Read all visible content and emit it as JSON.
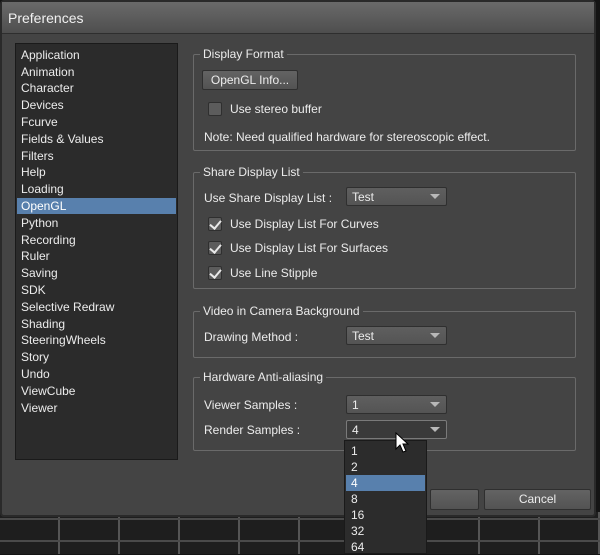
{
  "window": {
    "title": "Preferences"
  },
  "categories": {
    "selected": "OpenGL",
    "items": [
      "Application",
      "Animation",
      "Character",
      "Devices",
      "Fcurve",
      "Fields & Values",
      "Filters",
      "Help",
      "Loading",
      "OpenGL",
      "Python",
      "Recording",
      "Ruler",
      "Saving",
      "SDK",
      "Selective Redraw",
      "Shading",
      "SteeringWheels",
      "Story",
      "Undo",
      "ViewCube",
      "Viewer"
    ]
  },
  "display_format": {
    "title": "Display Format",
    "info_button": "OpenGL Info...",
    "stereo_label": "Use stereo buffer",
    "stereo_checked": false,
    "note": "Note: Need qualified hardware for stereoscopic effect."
  },
  "share_display_list": {
    "title": "Share Display List",
    "label": "Use Share Display List :",
    "value": "Test",
    "curves_label": "Use Display List For Curves",
    "curves_checked": true,
    "surfaces_label": "Use Display List For Surfaces",
    "surfaces_checked": true,
    "stipple_label": "Use Line Stipple",
    "stipple_checked": true
  },
  "video_background": {
    "title": "Video in Camera Background",
    "label": "Drawing Method :",
    "value": "Test"
  },
  "anti_aliasing": {
    "title": "Hardware Anti-aliasing",
    "viewer_label": "Viewer Samples :",
    "viewer_value": "1",
    "render_label": "Render Samples :",
    "render_value": "4",
    "render_options": [
      "1",
      "2",
      "4",
      "8",
      "16",
      "32",
      "64"
    ],
    "render_selected": "4"
  },
  "footer": {
    "cancel_label": "Cancel"
  },
  "colors": {
    "selection": "#5880ad",
    "panel": "#444444",
    "list_bg": "#2b2b2b"
  }
}
